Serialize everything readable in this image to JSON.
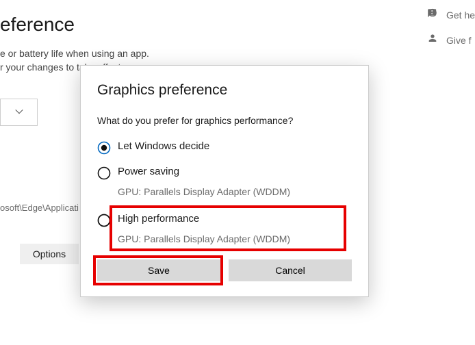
{
  "background": {
    "title_fragment": "eference",
    "desc_line1": "e or battery life when using an app.",
    "desc_line2": "r your changes to take effect.",
    "path_text": "osoft\\Edge\\Applicati",
    "options_button": "Options",
    "get_help": "Get he",
    "give_feedback": "Give f"
  },
  "dialog": {
    "title": "Graphics preference",
    "prompt": "What do you prefer for graphics performance?",
    "options": {
      "let_windows": {
        "label": "Let Windows decide"
      },
      "power_saving": {
        "label": "Power saving",
        "sub": "GPU: Parallels Display Adapter (WDDM)"
      },
      "high_perf": {
        "label": "High performance",
        "sub": "GPU: Parallels Display Adapter (WDDM)"
      }
    },
    "buttons": {
      "save": "Save",
      "cancel": "Cancel"
    }
  }
}
